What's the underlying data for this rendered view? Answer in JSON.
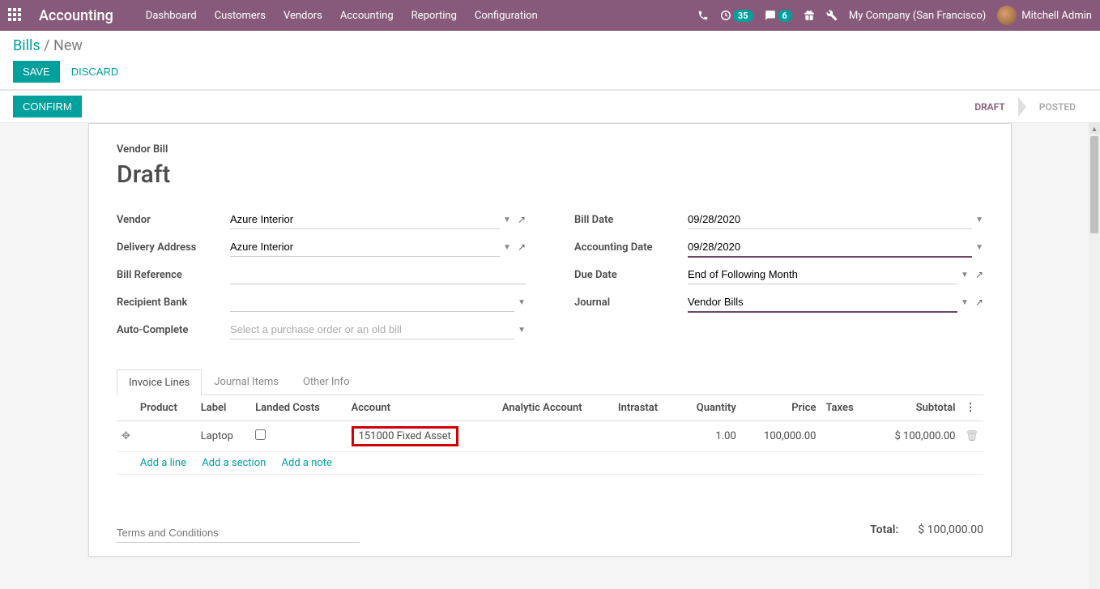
{
  "topnav": {
    "brand": "Accounting",
    "menu": [
      "Dashboard",
      "Customers",
      "Vendors",
      "Accounting",
      "Reporting",
      "Configuration"
    ],
    "activity_badge": "35",
    "chat_badge": "6",
    "company": "My Company (San Francisco)",
    "user": "Mitchell Admin"
  },
  "breadcrumb": {
    "parent": "Bills",
    "current": "New"
  },
  "actions": {
    "save": "SAVE",
    "discard": "DISCARD",
    "confirm": "CONFIRM"
  },
  "stages": {
    "draft": "DRAFT",
    "posted": "POSTED"
  },
  "sheet": {
    "type": "Vendor Bill",
    "title": "Draft",
    "left": {
      "vendor_label": "Vendor",
      "vendor": "Azure Interior",
      "delivery_label": "Delivery Address",
      "delivery": "Azure Interior",
      "billref_label": "Bill Reference",
      "billref": "",
      "bank_label": "Recipient Bank",
      "bank": "",
      "auto_label": "Auto-Complete",
      "auto_placeholder": "Select a purchase order or an old bill"
    },
    "right": {
      "billdate_label": "Bill Date",
      "billdate": "09/28/2020",
      "accdate_label": "Accounting Date",
      "accdate": "09/28/2020",
      "duedate_label": "Due Date",
      "duedate": "End of Following Month",
      "journal_label": "Journal",
      "journal": "Vendor Bills"
    }
  },
  "tabs": {
    "lines": "Invoice Lines",
    "journal": "Journal Items",
    "other": "Other Info"
  },
  "columns": {
    "product": "Product",
    "label": "Label",
    "landed": "Landed Costs",
    "account": "Account",
    "analytic": "Analytic Account",
    "intrastat": "Intrastat",
    "qty": "Quantity",
    "price": "Price",
    "taxes": "Taxes",
    "subtotal": "Subtotal"
  },
  "line": {
    "product": "",
    "label": "Laptop",
    "landed": false,
    "account": "151000 Fixed Asset",
    "analytic": "",
    "intrastat": "",
    "qty": "1.00",
    "price": "100,000.00",
    "taxes": "",
    "subtotal": "$ 100,000.00"
  },
  "addlinks": {
    "line": "Add a line",
    "section": "Add a section",
    "note": "Add a note"
  },
  "terms_placeholder": "Terms and Conditions",
  "total": {
    "label": "Total:",
    "value": "$ 100,000.00"
  }
}
